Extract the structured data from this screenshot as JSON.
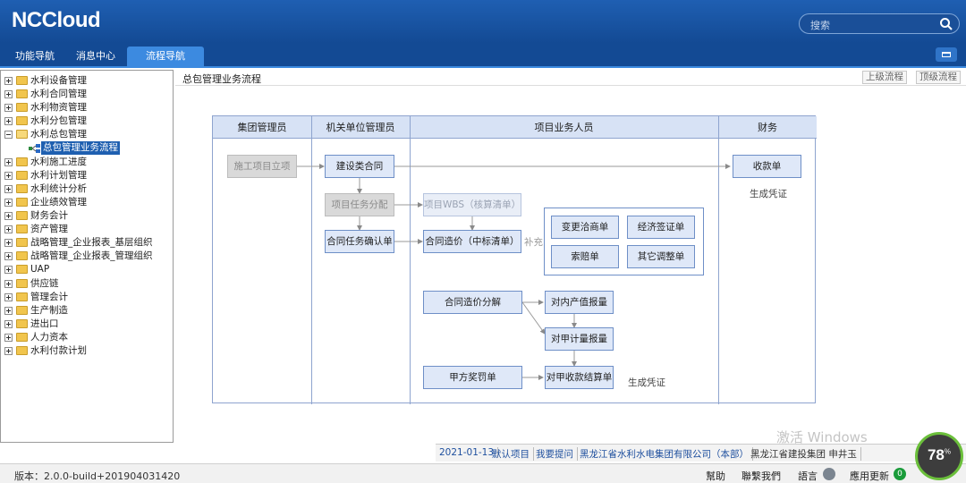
{
  "header": {
    "logo": "NCCloud",
    "search_placeholder": "搜索"
  },
  "tabs": [
    "功能导航",
    "消息中心",
    "流程导航"
  ],
  "active_tab": 2,
  "tree": [
    {
      "label": "水利设备管理"
    },
    {
      "label": "水利合同管理"
    },
    {
      "label": "水利物资管理"
    },
    {
      "label": "水利分包管理"
    },
    {
      "label": "水利总包管理",
      "expanded": true
    },
    {
      "label": "总包管理业务流程",
      "selected": true
    },
    {
      "label": "水利施工进度"
    },
    {
      "label": "水利计划管理"
    },
    {
      "label": "水利统计分析"
    },
    {
      "label": "企业绩效管理"
    },
    {
      "label": "财务会计"
    },
    {
      "label": "资产管理"
    },
    {
      "label": "战略管理_企业报表_基层组织"
    },
    {
      "label": "战略管理_企业报表_管理组织"
    },
    {
      "label": "UAP"
    },
    {
      "label": "供应链"
    },
    {
      "label": "管理会计"
    },
    {
      "label": "生产制造"
    },
    {
      "label": "进出口"
    },
    {
      "label": "人力资本"
    },
    {
      "label": "水利付款计划"
    }
  ],
  "content": {
    "breadcrumb": "总包管理业务流程",
    "btn_up": "上级流程",
    "btn_top": "顶级流程"
  },
  "diagram": {
    "lanes": [
      "集团管理员",
      "机关单位管理员",
      "项目业务人员",
      "财务"
    ],
    "boxes": {
      "b_lixiang": "施工项目立项",
      "b_jianshe": "建设类合同",
      "b_renwu": "项目任务分配",
      "b_wbs": "项目WBS（核算清单）",
      "b_hetong_renwu": "合同任务确认单",
      "b_zaojia": "合同造价（中标清单）",
      "b_shoukuan": "收款单",
      "b_biangeng": "变更洽商单",
      "b_jingji": "经济签证单",
      "b_suopei": "索赔单",
      "b_qita": "其它调整单",
      "b_fenjie": "合同造价分解",
      "b_neibu": "对内产值报量",
      "b_jiafang_jiliang": "对甲计量报量",
      "b_jiangfa": "甲方奖罚单",
      "b_jiesuan": "对甲收款结算单"
    },
    "texts": {
      "t_pz1": "生成凭证",
      "t_pz2": "生成凭证",
      "t_buchong": "补充"
    }
  },
  "status": {
    "date": "2021-01-13",
    "default_project": "默认项目",
    "ask": "我要提问",
    "org": "黑龙江省水利水电集团有限公司（本部）",
    "user": "黑龙江省建投集团 申井玉"
  },
  "footer": {
    "version": "版本：2.0.0-build+201904031420",
    "help": "幫助",
    "contact": "聯繫我們",
    "lang": "語言",
    "update": "應用更新",
    "update_count": "0"
  },
  "watermark": "激活 Windows",
  "gauge": {
    "value": "78",
    "unit": "%"
  },
  "colors": {
    "header": "#1f5fb2",
    "tab_active": "#3c8ae0",
    "box": "#dfe8f8",
    "lane": "#d7e2f5"
  }
}
